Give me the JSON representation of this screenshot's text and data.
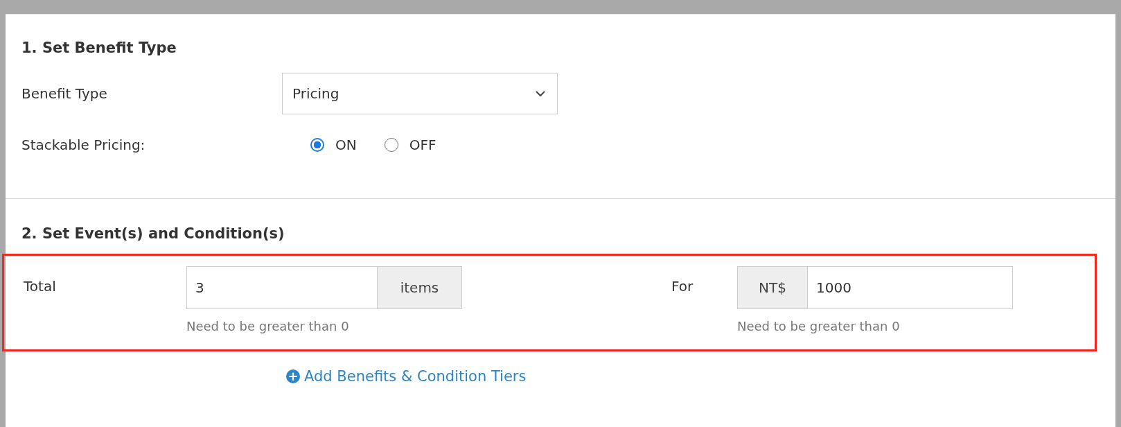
{
  "sections": [
    {
      "heading": "1. Set Benefit Type"
    },
    {
      "heading": "2. Set Event(s) and Condition(s)"
    }
  ],
  "benefit_type": {
    "label": "Benefit Type",
    "value": "Pricing"
  },
  "stackable_pricing": {
    "label": "Stackable Pricing:",
    "options": [
      {
        "label": "ON",
        "selected": true
      },
      {
        "label": "OFF",
        "selected": false
      }
    ]
  },
  "condition": {
    "highlighted": true,
    "total_label": "Total",
    "quantity": {
      "value": "3",
      "suffix": "items",
      "help": "Need to be greater than 0"
    },
    "for_label": "For",
    "price": {
      "prefix": "NT$",
      "value": "1000",
      "help": "Need to be greater than 0"
    }
  },
  "add_link": {
    "icon": "+",
    "label": "Add Benefits & Condition Tiers"
  }
}
